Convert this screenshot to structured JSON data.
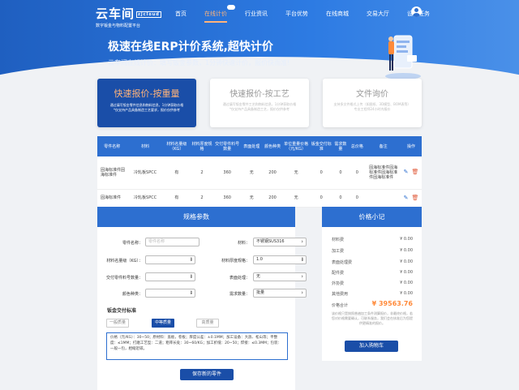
{
  "logo": {
    "brand": "云车间",
    "tag": "zjcloud",
    "slogan": "数字钣金与物料配置平台"
  },
  "nav": [
    "首页",
    "在线计价",
    "行业资讯",
    "平台优势",
    "在线商城",
    "交易大厅",
    "设计任务"
  ],
  "nav_active_index": 1,
  "hero": {
    "title": "极速在线ERP计价系统,超快计价",
    "subtitle": "云车间在线计价：填写钣金参数，1分钟快速计价，报价快而准!"
  },
  "cards": [
    {
      "title": "快速报价-按重量",
      "desc1": "通过填写钣金零件信息和物料信息，1分钟获取价格",
      "desc2": "*仅支持产品具备制造工艺要求，报价仅供参考",
      "active": true
    },
    {
      "title": "快速报价-按工艺",
      "desc1": "通过填写钣金零件工艺和物料信息，1分钟获取价格",
      "desc2": "*仅支持产品具备制造工艺，报价仅供参考",
      "active": false
    },
    {
      "title": "文件询价",
      "desc1": "支持多文件格式上传（如图纸、3D模型、BOM表等）",
      "desc2": "专业工程师24小时内报价",
      "active": false
    }
  ],
  "table": {
    "headers": [
      "零件名称",
      "材料",
      "材料名量级（KG）",
      "材料厚度规格",
      "交付零件料号数量",
      "表面处理",
      "颜色种类",
      "单位重量价格（元/KG）",
      "钣金交付标准",
      "需求数量",
      "总价格",
      "备注",
      "操作"
    ],
    "rows": [
      [
        "固海标准件固海标准件",
        "冷轧板SPCC",
        "有",
        "2",
        "360",
        "无",
        "200",
        "无",
        "0",
        "0",
        "0",
        "固海标准件固海标准件固海标准件固海标准件",
        ""
      ],
      [
        "固海标准件",
        "冷轧板SPCC",
        "有",
        "2",
        "360",
        "无",
        "200",
        "无",
        "0",
        "0",
        "0",
        "",
        ""
      ]
    ]
  },
  "spec": {
    "title": "规格参数",
    "part_name_label": "零件名称：",
    "part_name_placeholder": "零件名称",
    "material_label": "材料：",
    "material_value": "不锈钢SUS316",
    "weight_label": "材料名量级（KG）：",
    "thickness_label": "材料厚度规格：",
    "thickness_value": "1.0",
    "qty_label": "交付零件料号数量：",
    "surface_label": "表面处理：",
    "surface_value": "无",
    "color_label": "颜色种类：",
    "demand_label": "需求数量：",
    "demand_value": "批量",
    "standard_title": "钣金交付标准",
    "options": [
      "一般质量",
      "中等质量",
      "高质量"
    ],
    "options_active": 1,
    "detail": "价格（元/KG）：30~50；原材料：盖板，卷板；厚度公差：±0.1MM；加工设备：大族、松山等；平整度：≤1MM；打磨工艺型：二道；粗率长处：30~60/KG；加工折缝：20~50；焊接：≤0.3MM；包装：一般一包，相缩近碳。",
    "save_button": "保存新的零件"
  },
  "price": {
    "title": "价格小记",
    "rows": [
      {
        "label": "材料费",
        "value": "¥ 0.00"
      },
      {
        "label": "加工费",
        "value": "¥ 0.00"
      },
      {
        "label": "表面处理费",
        "value": "¥ 0.00"
      },
      {
        "label": "配件费",
        "value": "¥ 0.00"
      },
      {
        "label": "外协费",
        "value": "¥ 0.00"
      },
      {
        "label": "其他费用",
        "value": "¥ 0.00"
      }
    ],
    "total_label": "价格合计",
    "total_value": "¥ 39563.76",
    "note": "该价格只是按照普遍加工条件测算报价，非最终价格，若您对价格需要确认，可联系服务，我们会在核准后为您提供更精准的报价。",
    "cart_button": "加入购物车"
  },
  "colors": {
    "primary": "#2d6fd0",
    "dark_primary": "#1a4ea8",
    "accent": "#ff8a3a"
  }
}
